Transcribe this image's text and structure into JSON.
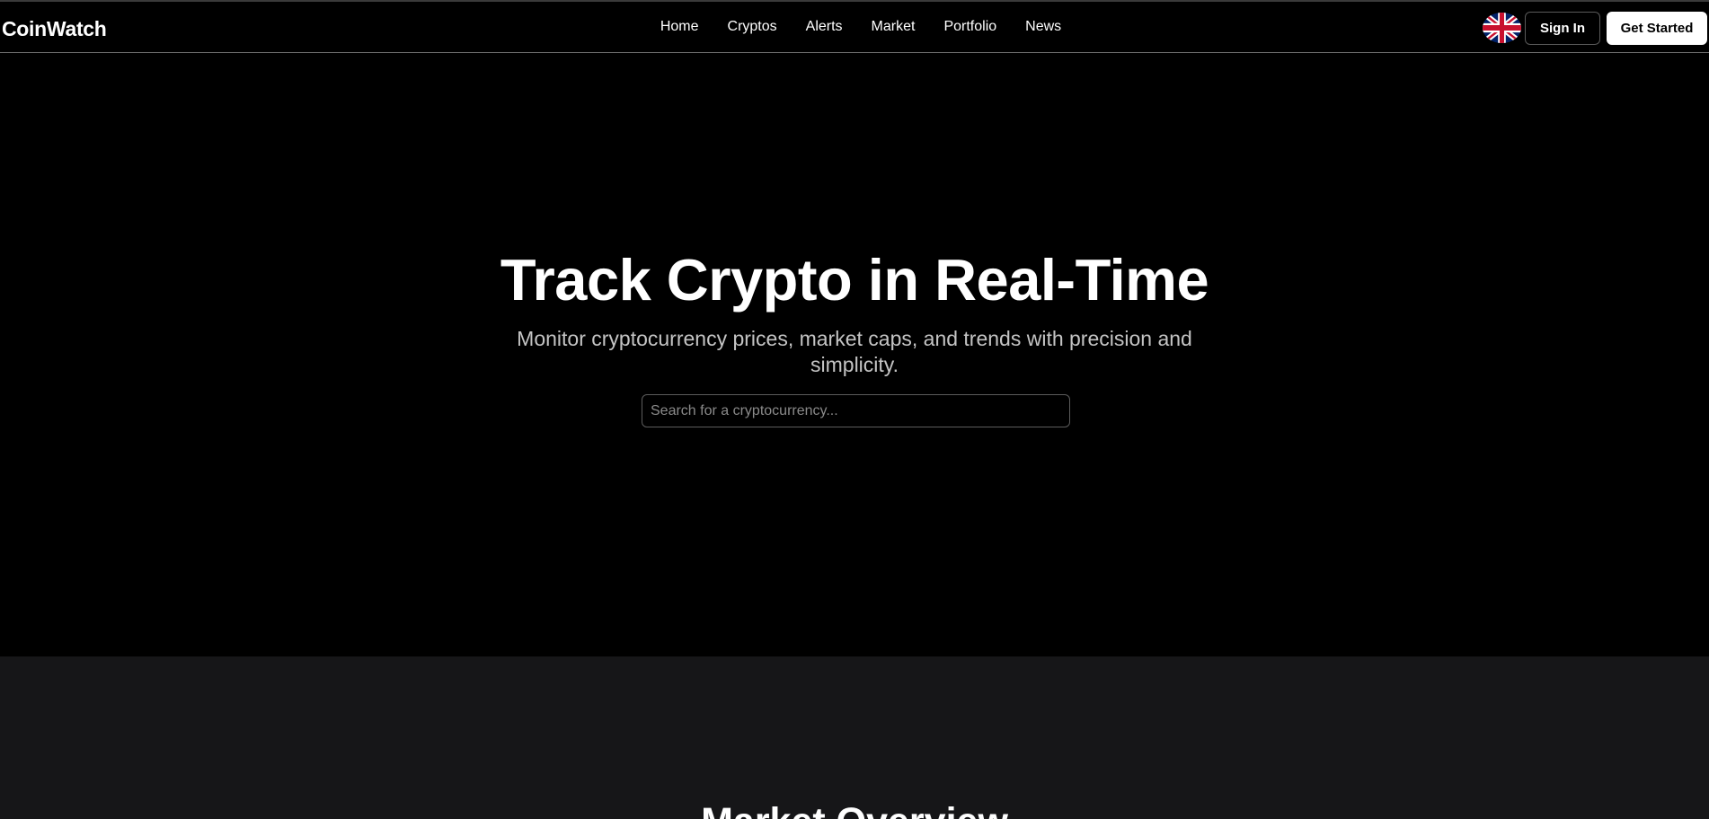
{
  "brand": {
    "name": "CoinWatch"
  },
  "nav": {
    "items": [
      {
        "label": "Home"
      },
      {
        "label": "Cryptos"
      },
      {
        "label": "Alerts"
      },
      {
        "label": "Market"
      },
      {
        "label": "Portfolio"
      },
      {
        "label": "News"
      }
    ]
  },
  "header": {
    "language_icon": "uk-flag-icon",
    "signin_label": "Sign In",
    "get_started_label": "Get Started"
  },
  "hero": {
    "title": "Track Crypto in Real-Time",
    "subtitle": "Monitor cryptocurrency prices, market caps, and trends with precision and simplicity.",
    "search_placeholder": "Search for a cryptocurrency...",
    "search_value": ""
  },
  "overview": {
    "title": "Market Overview"
  },
  "colors": {
    "background": "#000000",
    "section_background": "#161618",
    "text_primary": "#ffffff",
    "text_secondary": "#c4c4c4",
    "border": "#5c5c5c"
  }
}
